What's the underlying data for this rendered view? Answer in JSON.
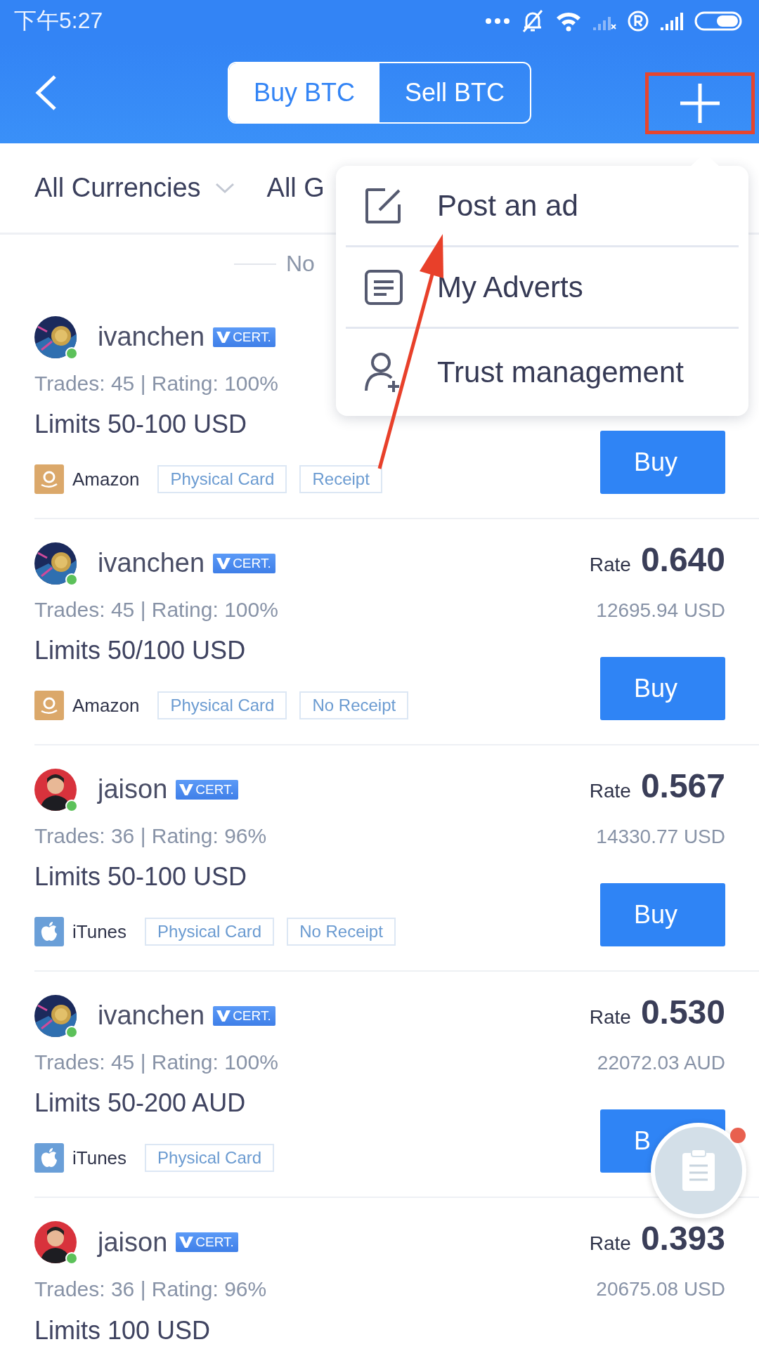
{
  "status_bar": {
    "time": "下午5:27"
  },
  "header": {
    "tabs": [
      {
        "label": "Buy BTC",
        "selected": true
      },
      {
        "label": "Sell BTC",
        "selected": false
      }
    ],
    "highlight_add": true
  },
  "filters": [
    {
      "label": "All Currencies",
      "dropdown": true
    },
    {
      "label": "All G",
      "dropdown": false
    }
  ],
  "notice": {
    "text": "No"
  },
  "offers": [
    {
      "user": "ivanchen",
      "avatar": {
        "kind": "coin"
      },
      "online": true,
      "badge": "CERT.",
      "stats": "Trades: 45 | Rating: 100%",
      "limits": "Limits 50-100 USD",
      "platform": {
        "kind": "amazon",
        "name": "Amazon"
      },
      "tags": [
        "Physical Card",
        "Receipt"
      ],
      "action": "Buy"
    },
    {
      "user": "ivanchen",
      "avatar": {
        "kind": "coin"
      },
      "online": true,
      "badge": "CERT.",
      "stats": "Trades: 45 | Rating: 100%",
      "limits": "Limits 50/100 USD",
      "rate_label": "Rate",
      "rate": "0.640",
      "amount": "12695.94 USD",
      "platform": {
        "kind": "amazon",
        "name": "Amazon"
      },
      "tags": [
        "Physical Card",
        "No Receipt"
      ],
      "action": "Buy"
    },
    {
      "user": "jaison",
      "avatar": {
        "kind": "person"
      },
      "online": true,
      "badge": "CERT.",
      "stats": "Trades: 36 | Rating: 96%",
      "limits": "Limits 50-100 USD",
      "rate_label": "Rate",
      "rate": "0.567",
      "amount": "14330.77 USD",
      "platform": {
        "kind": "itunes",
        "name": "iTunes"
      },
      "tags": [
        "Physical Card",
        "No Receipt"
      ],
      "action": "Buy"
    },
    {
      "user": "ivanchen",
      "avatar": {
        "kind": "coin"
      },
      "online": true,
      "badge": "CERT.",
      "stats": "Trades: 45 | Rating: 100%",
      "limits": "Limits 50-200 AUD",
      "rate_label": "Rate",
      "rate": "0.530",
      "amount": "22072.03 AUD",
      "platform": {
        "kind": "itunes",
        "name": "iTunes"
      },
      "tags": [
        "Physical Card"
      ],
      "action": "B"
    },
    {
      "user": "jaison",
      "avatar": {
        "kind": "person"
      },
      "online": true,
      "badge": "CERT.",
      "stats": "Trades: 36 | Rating: 96%",
      "limits": "Limits 100 USD",
      "rate_label": "Rate",
      "rate": "0.393",
      "amount": "20675.08 USD"
    }
  ],
  "menu": {
    "items": [
      {
        "label": "Post an ad"
      },
      {
        "label": "My Adverts"
      },
      {
        "label": "Trust management"
      }
    ]
  },
  "float_button": {
    "notification": true
  }
}
